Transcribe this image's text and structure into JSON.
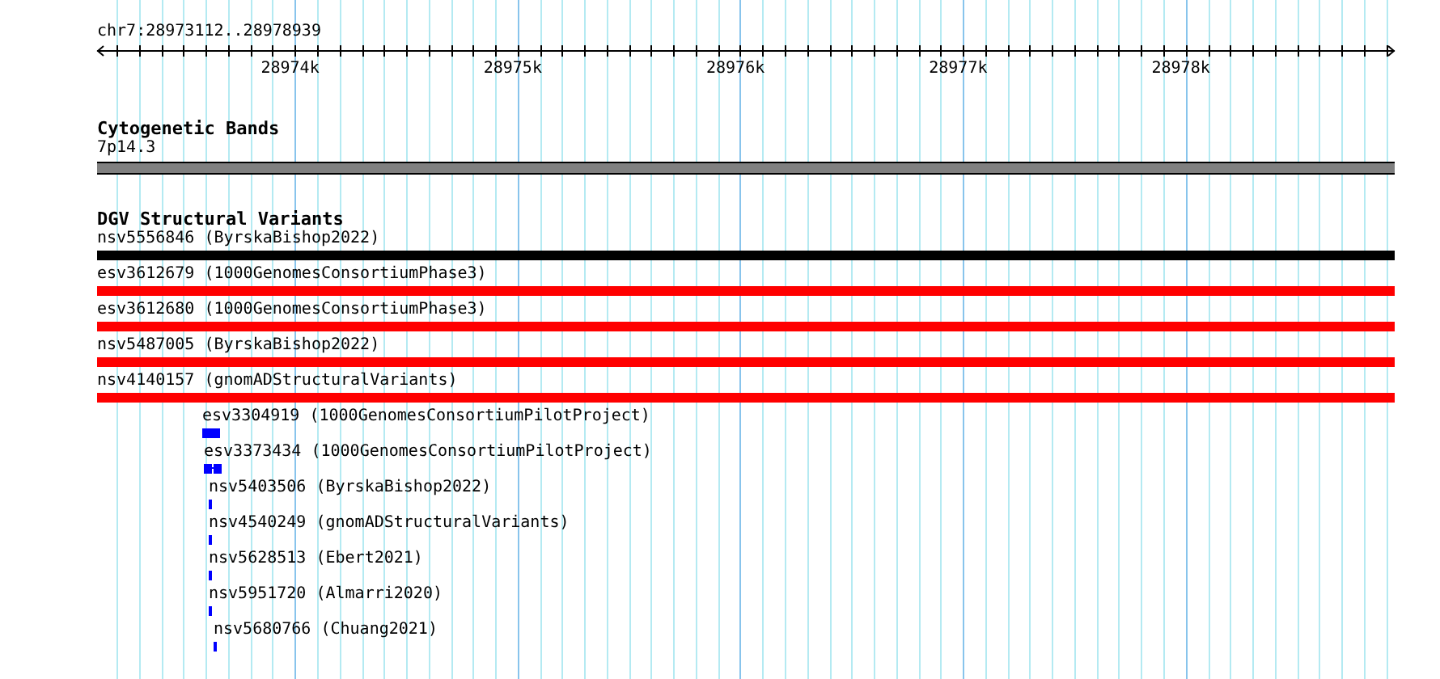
{
  "ruler": {
    "location": "chr7:28973112..28978939",
    "ticks": [
      "28974k",
      "28975k",
      "28976k",
      "28977k",
      "28978k"
    ]
  },
  "tracks": [
    {
      "title": "Cytogenetic Bands",
      "kind": "bands",
      "features": [
        {
          "label": "7p14.3",
          "color": "#808080"
        }
      ]
    },
    {
      "title": "DGV Structural Variants",
      "kind": "variants",
      "features": [
        {
          "label": "nsv5556846 (ByrskaBishop2022)",
          "color": "#000000"
        },
        {
          "label": "esv3612679 (1000GenomesConsortiumPhase3)",
          "color": "#ff0000"
        },
        {
          "label": "esv3612680 (1000GenomesConsortiumPhase3)",
          "color": "#ff0000"
        },
        {
          "label": "nsv5487005 (ByrskaBishop2022)",
          "color": "#ff0000"
        },
        {
          "label": "nsv4140157 (gnomADStructuralVariants)",
          "color": "#ff0000"
        },
        {
          "label": "esv3304919 (1000GenomesConsortiumPilotProject)",
          "color": "#0000ff"
        },
        {
          "label": "esv3373434 (1000GenomesConsortiumPilotProject)",
          "color": "#0000ff"
        },
        {
          "label": "nsv5403506 (ByrskaBishop2022)",
          "color": "#0000ff"
        },
        {
          "label": "nsv4540249 (gnomADStructuralVariants)",
          "color": "#0000ff"
        },
        {
          "label": "nsv5628513 (Ebert2021)",
          "color": "#0000ff"
        },
        {
          "label": "nsv5951720 (Almarri2020)",
          "color": "#0000ff"
        },
        {
          "label": "nsv5680766 (Chuang2021)",
          "color": "#0000ff"
        }
      ]
    }
  ]
}
